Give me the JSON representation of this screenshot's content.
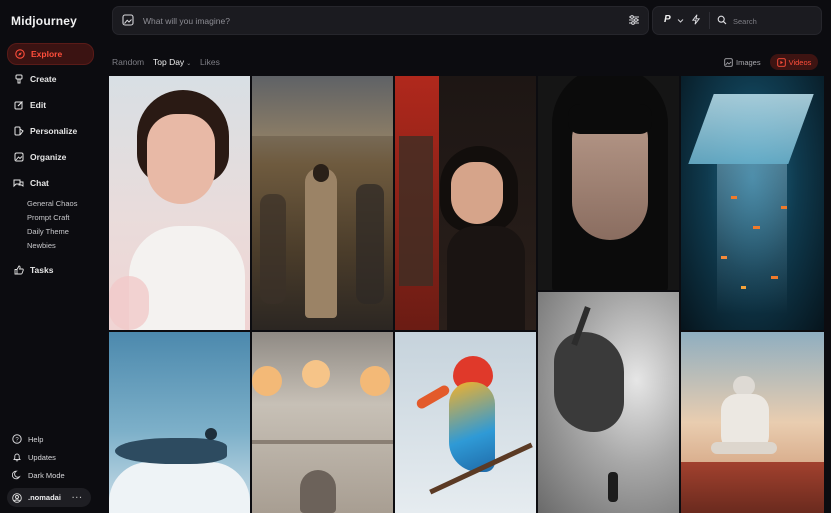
{
  "app": {
    "title": "Midjourney"
  },
  "nav": [
    {
      "label": "Explore",
      "icon": "compass-icon",
      "active": true
    },
    {
      "label": "Create",
      "icon": "brush-icon"
    },
    {
      "label": "Edit",
      "icon": "pencil-square-icon"
    },
    {
      "label": "Personalize",
      "icon": "palette-icon"
    },
    {
      "label": "Organize",
      "icon": "image-folder-icon"
    },
    {
      "label": "Chat",
      "icon": "chat-bubbles-icon"
    }
  ],
  "chat_rooms": [
    "General Chaos",
    "Prompt Craft",
    "Daily Theme",
    "Newbies"
  ],
  "tasks": {
    "label": "Tasks",
    "icon": "thumbs-up-icon"
  },
  "bottom": {
    "help": "Help",
    "updates": "Updates",
    "dark_mode": "Dark Mode",
    "user": ".nomadai",
    "user_menu": "···"
  },
  "imagine": {
    "placeholder": "What will you imagine?"
  },
  "toolbar": {
    "personalize_label": "P",
    "search_placeholder": "Search"
  },
  "feed_tabs": [
    {
      "label": "Random",
      "active": false
    },
    {
      "label": "Top Day",
      "active": true,
      "chevron": "⌄"
    },
    {
      "label": "Likes",
      "active": false
    }
  ],
  "filters": {
    "images": "Images",
    "videos": "Videos",
    "active": "Videos"
  },
  "gallery": [
    {
      "subject": "woman-portrait-pastel",
      "colors": [
        "#e9c9c2",
        "#cfd6dc",
        "#f2e6e6"
      ]
    },
    {
      "subject": "man-coat-city-street",
      "colors": [
        "#6e5a3e",
        "#a08660",
        "#2d2a26"
      ]
    },
    {
      "subject": "girl-vending-machine",
      "colors": [
        "#1a1412",
        "#7a2a1e",
        "#3a2a22"
      ]
    },
    {
      "subject": "dark-hair-woman-closeup",
      "colors": [
        "#141414",
        "#7a6a60",
        "#2a2a2c"
      ]
    },
    {
      "subject": "fish-underwater-portal",
      "colors": [
        "#0d2a3a",
        "#1f6a8a",
        "#0a1620"
      ]
    },
    {
      "subject": "whale-above-clouds",
      "colors": [
        "#6fa1bd",
        "#9ec3d6",
        "#dfe7ec"
      ]
    },
    {
      "subject": "interior-lamps-cat",
      "colors": [
        "#b8b0a6",
        "#d7cfc4",
        "#7a6f66"
      ]
    },
    {
      "subject": "glass-parrot-branch",
      "colors": [
        "#dfe6ec",
        "#c7d3dc",
        "#f0b22f"
      ]
    },
    {
      "subject": "smoke-dragon-grey",
      "colors": [
        "#bdbdbd",
        "#8a8a8a",
        "#5a5a5a"
      ]
    },
    {
      "subject": "astronaut-flower-field",
      "colors": [
        "#f0d3b6",
        "#c8a58e",
        "#a03a2a"
      ]
    }
  ]
}
